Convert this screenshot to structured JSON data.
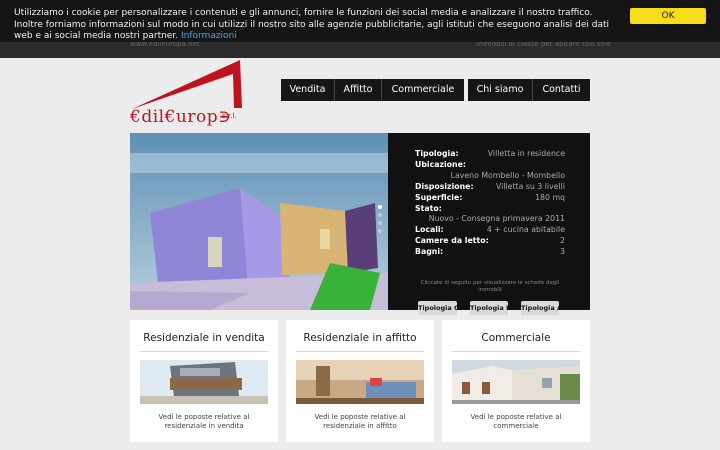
{
  "cookie": {
    "text": "Utilizziamo i cookie per personalizzare i contenuti e gli annunci, fornire le funzioni dei social media e analizzare il nostro traffico. Inoltre forniamo informazioni sul modo in cui utilizzi il nostro sito alle agenzie pubblicitarie, agli istituti che eseguono analisi dei dati web e ai social media nostri partner.",
    "link": "Informazioni",
    "ok": "OK"
  },
  "header": {
    "ghost_left": "www.edileuropa.net",
    "ghost_right": "Immobili di classe per abitare con stile"
  },
  "logo": {
    "brand": "€dil€urop∋",
    "suffix": "s.r.l."
  },
  "nav": {
    "items": [
      "Vendita",
      "Affitto",
      "Commerciale",
      "Chi siamo",
      "Contatti"
    ]
  },
  "hero": {
    "details": [
      {
        "k": "Tipologia:",
        "v": "Villetta in residence"
      },
      {
        "k": "Ubicazione:",
        "v": "Laveno Mombello - Mombello"
      },
      {
        "k": "Disposizione:",
        "v": "Villetta su 3 livelli"
      },
      {
        "k": "Superficie:",
        "v": "180 mq"
      },
      {
        "k": "Stato:",
        "v": "Nuovo - Consegna primavera 2011"
      },
      {
        "k": "Locali:",
        "v": "4 + cucina abitabile"
      },
      {
        "k": "Camere da letto:",
        "v": "2"
      },
      {
        "k": "Bagni:",
        "v": "3"
      }
    ],
    "hint": "Cliccate di seguito per visualizzare le schede degli immobili",
    "tabs": [
      "Tipologia C",
      "Tipologia B",
      "Tipologia A"
    ]
  },
  "cards": [
    {
      "title": "Residenziale in vendita",
      "desc": "Vedi le poposte relative al residenziale in vendita"
    },
    {
      "title": "Residenziale in affitto",
      "desc": "Vedi le poposte relative al residenziale in affitto"
    },
    {
      "title": "Commerciale",
      "desc": "Vedi le poposte relative al commerciale"
    }
  ],
  "colors": {
    "accent": "#c0121e",
    "cookie_button": "#f5de17",
    "link": "#3fa9f5"
  }
}
